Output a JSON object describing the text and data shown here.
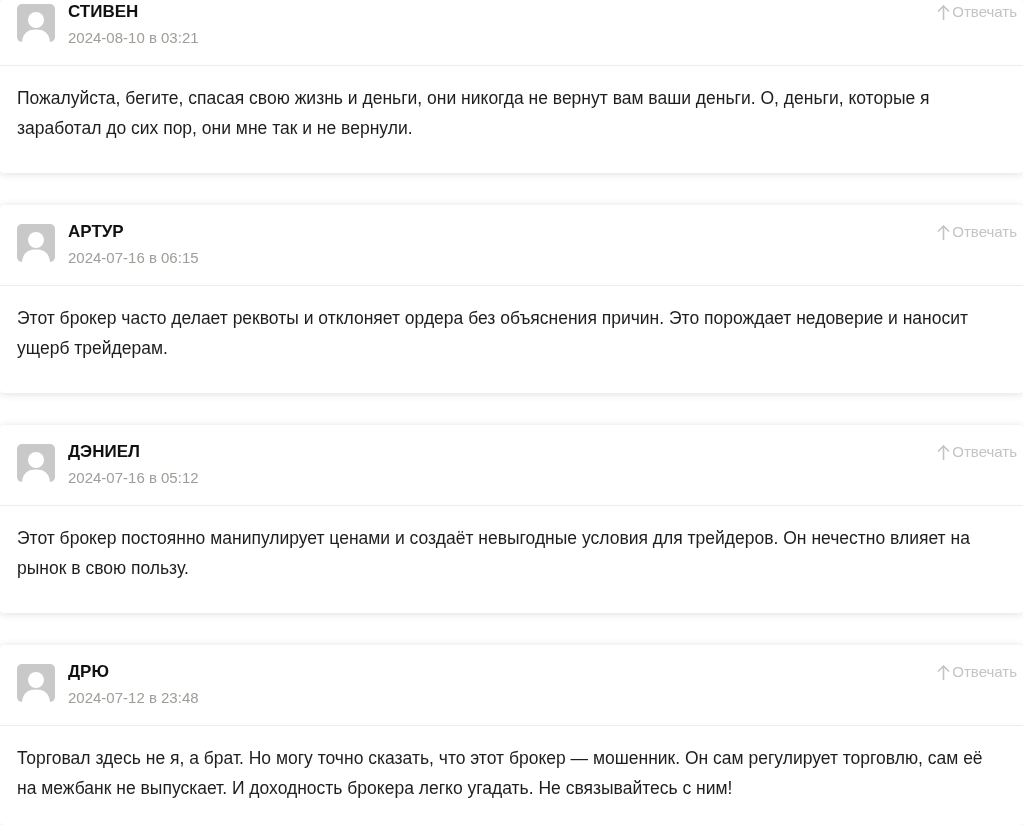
{
  "comments": [
    {
      "author": "СТИВЕН",
      "date": "2024-08-10 в 03:21",
      "reply": "Отвечать",
      "text": "Пожалуйста, бегите, спасая свою жизнь и деньги, они никогда не вернут вам ваши деньги. О, деньги, которые я заработал до сих пор, они мне так и не вернули."
    },
    {
      "author": "АРТУР",
      "date": "2024-07-16 в 06:15",
      "reply": "Отвечать",
      "text": "Этот брокер часто делает реквоты и отклоняет ордера без объяснения причин. Это порождает недоверие и наносит ущерб трейдерам."
    },
    {
      "author": "ДЭНИЕЛ",
      "date": "2024-07-16 в 05:12",
      "reply": "Отвечать",
      "text": "Этот брокер постоянно манипулирует ценами и создаёт невыгодные условия для трейдеров. Он нечестно влияет на рынок в свою пользу."
    },
    {
      "author": "ДРЮ",
      "date": "2024-07-12 в 23:48",
      "reply": "Отвечать",
      "text": "Торговал здесь не я, а брат. Но могу точно сказать, что этот брокер — мошенник. Он сам регулирует торговлю, сам её на межбанк не выпускает. И доходность брокера легко угадать. Не связывайтесь с ним!"
    }
  ]
}
